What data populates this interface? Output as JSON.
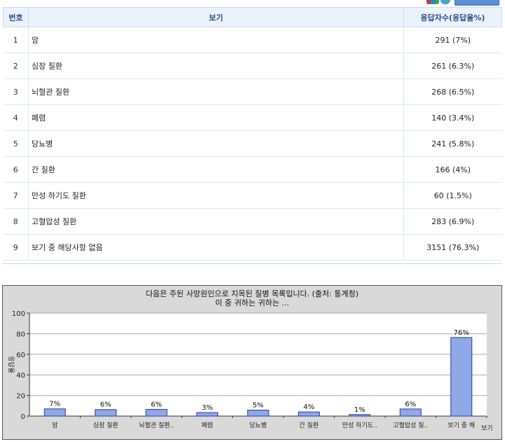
{
  "toolbar": {
    "icons": [
      "chart-icon",
      "refresh-icon"
    ],
    "button_label": ""
  },
  "table": {
    "headers": [
      "번호",
      "보기",
      "응답자수(응답율%)"
    ],
    "rows": [
      {
        "no": "1",
        "option": "암",
        "count": "291 (7%)"
      },
      {
        "no": "2",
        "option": "심장 질환",
        "count": "261 (6.3%)"
      },
      {
        "no": "3",
        "option": "뇌혈관 질환",
        "count": "268 (6.5%)"
      },
      {
        "no": "4",
        "option": "폐렴",
        "count": "140 (3.4%)"
      },
      {
        "no": "5",
        "option": "당뇨병",
        "count": "241 (5.8%)"
      },
      {
        "no": "6",
        "option": "간 질환",
        "count": "166 (4%)"
      },
      {
        "no": "7",
        "option": "만성 하기도 질환",
        "count": "60 (1.5%)"
      },
      {
        "no": "8",
        "option": "고혈압성 질환",
        "count": "283 (6.9%)"
      },
      {
        "no": "9",
        "option": "보기 중 해당사항 없음",
        "count": "3151 (76.3%)"
      }
    ]
  },
  "chart_data": {
    "type": "bar",
    "title": "다음은 주된 사망원인으로 지목된 질병 목록입니다. (출처: 통계청)",
    "subtitle": "이 중 귀하는 귀하는 ...",
    "xlabel": "보기",
    "ylabel": "응답율",
    "categories": [
      "암",
      "심장 질환",
      "뇌혈관 질환..",
      "폐렴",
      "당뇨병",
      "간 질환",
      "만성 하기도..",
      "고혈압성 질..",
      "보기 중 해"
    ],
    "values": [
      7,
      6.3,
      6.5,
      3.4,
      5.8,
      4,
      1.5,
      6.9,
      76.3
    ],
    "data_labels": [
      "7%",
      "6%",
      "6%",
      "3%",
      "5%",
      "4%",
      "1%",
      "6%",
      "76%"
    ],
    "yticks": [
      "0",
      "20",
      "40",
      "60",
      "80",
      "100"
    ],
    "ylim": [
      0,
      100
    ],
    "grid": true,
    "colors": {
      "bar": "#8fa8e8",
      "bar_border": "#2a3f8f",
      "grid": "#a8a8a8",
      "background": "#d9d9d9"
    }
  }
}
